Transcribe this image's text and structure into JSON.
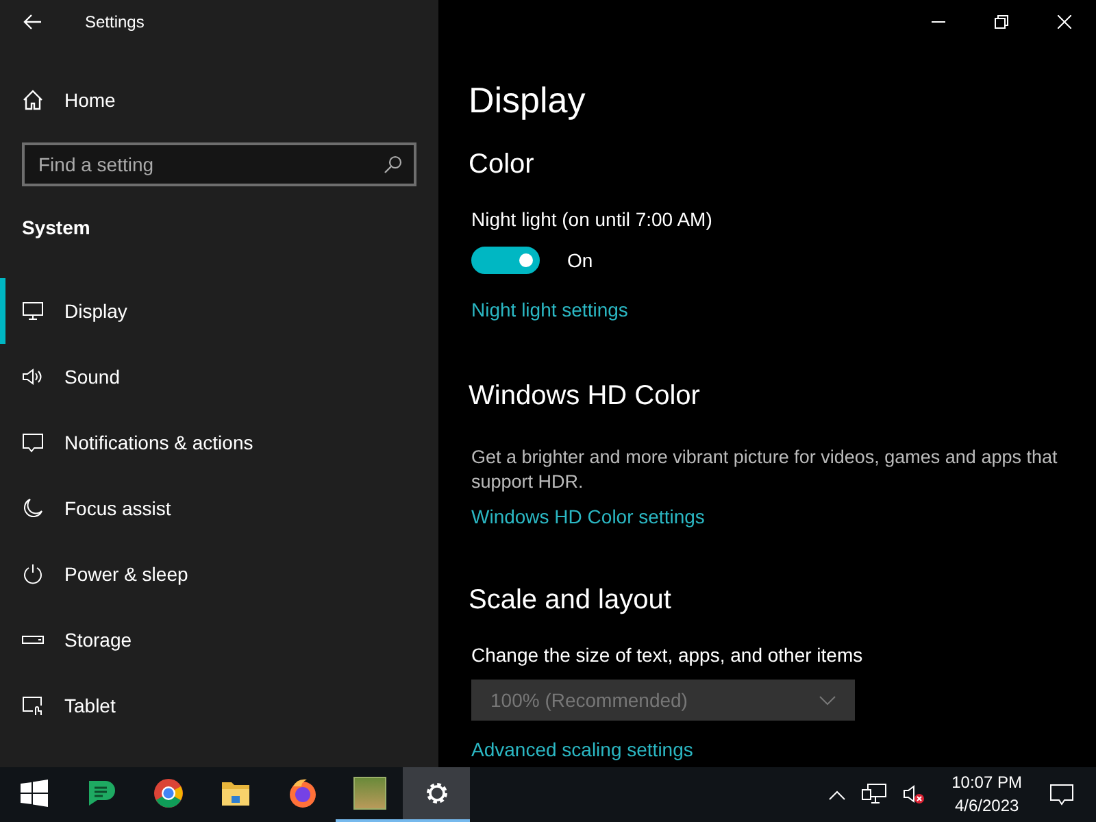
{
  "window": {
    "title": "Settings"
  },
  "sidebar": {
    "home": "Home",
    "search": {
      "placeholder": "Find a setting"
    },
    "section": "System",
    "items": [
      {
        "label": "Display",
        "kind": "monitor",
        "selected": true
      },
      {
        "label": "Sound",
        "kind": "speaker",
        "selected": false
      },
      {
        "label": "Notifications & actions",
        "kind": "message",
        "selected": false
      },
      {
        "label": "Focus assist",
        "kind": "moon",
        "selected": false
      },
      {
        "label": "Power & sleep",
        "kind": "power",
        "selected": false
      },
      {
        "label": "Storage",
        "kind": "drive",
        "selected": false
      },
      {
        "label": "Tablet",
        "kind": "tablet",
        "selected": false
      }
    ]
  },
  "content": {
    "title": "Display",
    "color": {
      "heading": "Color",
      "night_light": {
        "label": "Night light (on until 7:00 AM)",
        "on": true,
        "state_text": "On"
      },
      "link": "Night light settings"
    },
    "hd_color": {
      "heading": "Windows HD Color",
      "description": "Get a brighter and more vibrant picture for videos, games and apps that support HDR.",
      "link": "Windows HD Color settings"
    },
    "scale": {
      "heading": "Scale and layout",
      "label": "Change the size of text, apps, and other items",
      "dropdown": {
        "value": "100% (Recommended)",
        "disabled": true
      },
      "link": "Advanced scaling settings"
    }
  },
  "taskbar": {
    "apps": [
      {
        "kind": "start",
        "running": false,
        "selected": false
      },
      {
        "kind": "chat",
        "running": false,
        "selected": false
      },
      {
        "kind": "chrome",
        "running": false,
        "selected": false
      },
      {
        "kind": "folder",
        "running": false,
        "selected": false
      },
      {
        "kind": "firefox",
        "running": false,
        "selected": false
      },
      {
        "kind": "photo",
        "running": true,
        "selected": false
      },
      {
        "kind": "gear",
        "running": true,
        "selected": true
      }
    ],
    "clock": {
      "time": "10:07 PM",
      "date": "4/6/2023"
    }
  }
}
